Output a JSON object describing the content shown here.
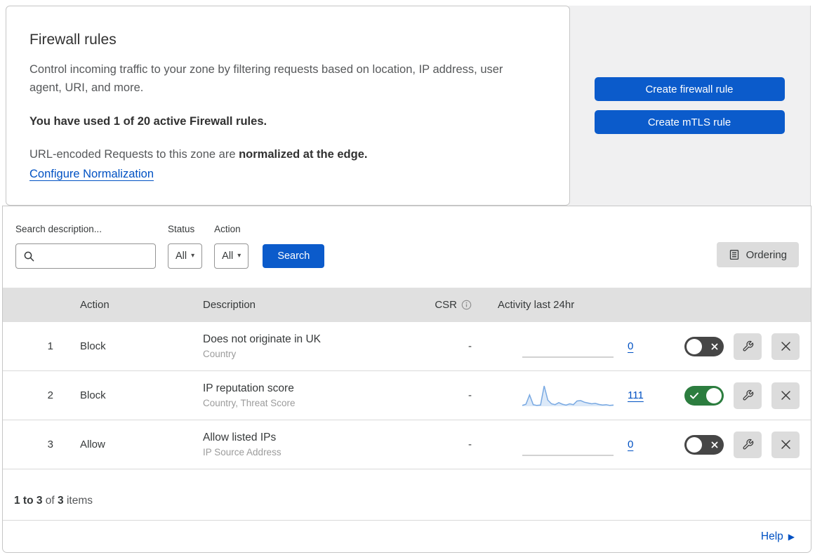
{
  "colors": {
    "primary_button": "#0b5bcb",
    "link": "#0051c3",
    "toggle_on": "#2c7d3f",
    "toggle_off": "#464646",
    "spark_line": "#79a9e2",
    "spark_fill": "#dce9f8",
    "spark_flat": "#c4c4c4",
    "table_header_bg": "#e0e0e0",
    "actions_panel_bg": "#f0f0f1"
  },
  "icons": {
    "caret_down": "▾",
    "help_arrow": "▶"
  },
  "header_card": {
    "title": "Firewall rules",
    "description": "Control incoming traffic to your zone by filtering requests based on location, IP address, user agent, URI, and more.",
    "usage_bold": "You have used 1 of 20 active Firewall rules.",
    "normalization_prefix": "URL-encoded Requests to this zone are ",
    "normalization_bold": "normalized at the edge.",
    "normalization_link": "Configure Normalization"
  },
  "actions_panel": {
    "create_firewall_label": "Create firewall rule",
    "create_mtls_label": "Create mTLS rule"
  },
  "filter_bar": {
    "search_label": "Search description...",
    "search_value": "",
    "status_label": "Status",
    "status_value": "All",
    "action_label": "Action",
    "action_value": "All",
    "search_button": "Search",
    "ordering_button": "Ordering"
  },
  "table": {
    "headers": {
      "action": "Action",
      "description": "Description",
      "csr": "CSR",
      "activity": "Activity last 24hr"
    },
    "rows": [
      {
        "num": "1",
        "action": "Block",
        "description": "Does not originate in UK",
        "fields": "Country",
        "csr": "-",
        "count": "0",
        "enabled": false,
        "spark": [
          0,
          0
        ]
      },
      {
        "num": "2",
        "action": "Block",
        "description": "IP reputation score",
        "fields": "Country, Threat Score",
        "csr": "-",
        "count": "111",
        "enabled": true,
        "spark": [
          4,
          10,
          56,
          8,
          4,
          6,
          100,
          30,
          12,
          8,
          18,
          10,
          6,
          12,
          8,
          26,
          28,
          20,
          16,
          12,
          14,
          9,
          6,
          8,
          4,
          6
        ]
      },
      {
        "num": "3",
        "action": "Allow",
        "description": "Allow listed IPs",
        "fields": "IP Source Address",
        "csr": "-",
        "count": "0",
        "enabled": false,
        "spark": [
          0,
          0
        ]
      }
    ]
  },
  "footer": {
    "range_bold": "1 to 3",
    "of_text": "of",
    "total_bold": "3",
    "items_text": "items",
    "help_label": "Help"
  }
}
